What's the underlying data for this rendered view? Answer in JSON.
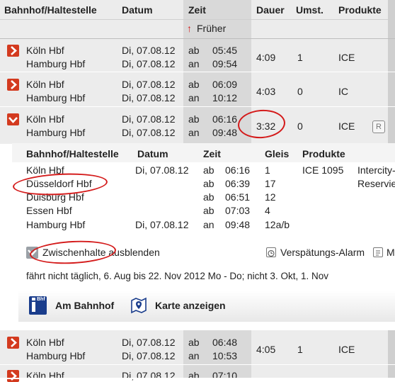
{
  "header": {
    "station": "Bahnhof/Haltestelle",
    "datum": "Datum",
    "zeit": "Zeit",
    "dauer": "Dauer",
    "umst": "Umst.",
    "produkte": "Produkte",
    "earlier_arrow": "↑",
    "earlier": "Früher"
  },
  "connections": [
    {
      "from": "Köln Hbf",
      "to": "Hamburg Hbf",
      "date_dep": "Di, 07.08.12",
      "date_arr": "Di, 07.08.12",
      "dep_tag": "ab",
      "dep_time": "05:45",
      "arr_tag": "an",
      "arr_time": "09:54",
      "duration": "4:09",
      "changes": "1",
      "product": "ICE"
    },
    {
      "from": "Köln Hbf",
      "to": "Hamburg Hbf",
      "date_dep": "Di, 07.08.12",
      "date_arr": "Di, 07.08.12",
      "dep_tag": "ab",
      "dep_time": "06:09",
      "arr_tag": "an",
      "arr_time": "10:12",
      "duration": "4:03",
      "changes": "0",
      "product": "IC"
    },
    {
      "from": "Köln Hbf",
      "to": "Hamburg Hbf",
      "date_dep": "Di, 07.08.12",
      "date_arr": "Di, 07.08.12",
      "dep_tag": "ab",
      "dep_time": "06:16",
      "arr_tag": "an",
      "arr_time": "09:48",
      "duration": "3:32",
      "changes": "0",
      "product": "ICE",
      "extra_icon": "R"
    },
    {
      "from": "Köln Hbf",
      "to": "Hamburg Hbf",
      "date_dep": "Di, 07.08.12",
      "date_arr": "Di, 07.08.12",
      "dep_tag": "ab",
      "dep_time": "06:48",
      "arr_tag": "an",
      "arr_time": "10:53",
      "duration": "4:05",
      "changes": "1",
      "product": "ICE"
    },
    {
      "from": "Köln Hbf",
      "date_dep": "Di, 07.08.12",
      "dep_tag": "ab",
      "dep_time": "07:10"
    }
  ],
  "detail": {
    "headers": {
      "station": "Bahnhof/Haltestelle",
      "datum": "Datum",
      "zeit": "Zeit",
      "gleis": "Gleis",
      "produkte": "Produkte"
    },
    "stops": [
      {
        "station": "Köln Hbf",
        "date": "Di, 07.08.12",
        "tag": "ab",
        "time": "06:16",
        "gleis": "1",
        "product": "ICE 1095",
        "extra": "Intercity-"
      },
      {
        "station": "Düsseldorf Hbf",
        "date": "",
        "tag": "ab",
        "time": "06:39",
        "gleis": "17",
        "product": "",
        "extra": "Reservie"
      },
      {
        "station": "Duisburg Hbf",
        "date": "",
        "tag": "ab",
        "time": "06:51",
        "gleis": "12",
        "product": "",
        "extra": ""
      },
      {
        "station": "Essen Hbf",
        "date": "",
        "tag": "ab",
        "time": "07:03",
        "gleis": "4",
        "product": "",
        "extra": ""
      },
      {
        "station": "Hamburg Hbf",
        "date": "Di, 07.08.12",
        "tag": "an",
        "time": "09:48",
        "gleis": "12a/b",
        "product": "",
        "extra": ""
      }
    ],
    "hide_stops": "Zwischenhalte ausblenden",
    "delay_alarm": "Verspätungs-Alarm",
    "cut_link": "M",
    "note": "fährt nicht täglich, 6. Aug bis 22. Nov 2012 Mo - Do; nicht 3. Okt, 1. Nov",
    "station_link": "Am Bahnhof",
    "station_icon_text": "Bhf",
    "map_link": "Karte anzeigen"
  },
  "colors": {
    "accent": "#d33a1f",
    "annotation": "#d41a1a",
    "header_bg": "#ececec",
    "zeit_bg": "#d9d9d9"
  }
}
